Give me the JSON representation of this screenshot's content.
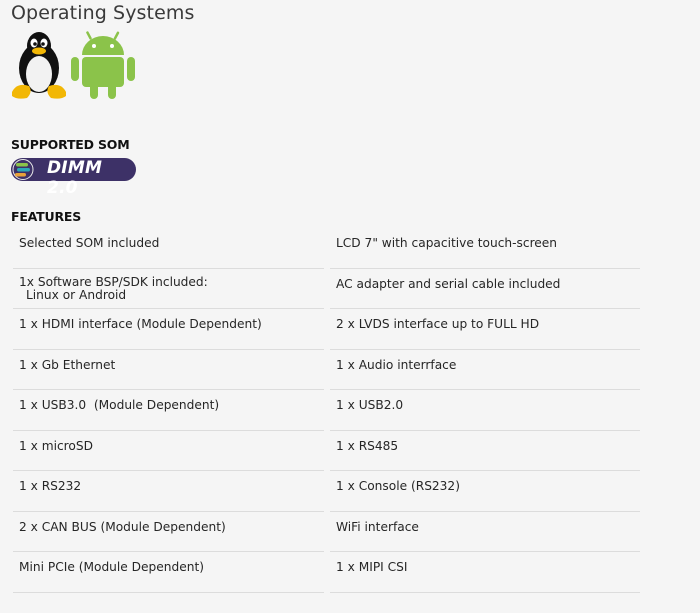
{
  "heading": "Operating Systems",
  "os_icons": [
    "linux-tux-icon",
    "android-icon"
  ],
  "supported_som": {
    "label": "SUPPORTED SOM",
    "badge_text": "DIMM 2.0",
    "badge_color": "#3d3167"
  },
  "features": {
    "label": "FEATURES",
    "rows": [
      {
        "left": "Selected SOM included",
        "right": "LCD 7\" with capacitive touch-screen"
      },
      {
        "left": "1x Software BSP/SDK included:",
        "left_sub": "Linux or Android",
        "right": "AC adapter and serial cable included"
      },
      {
        "left": "1 x HDMI interface (Module Dependent)",
        "right": "2 x LVDS interface up to FULL HD"
      },
      {
        "left": "1 x Gb Ethernet",
        "right": "1 x Audio interrface"
      },
      {
        "left": "1 x USB3.0  (Module Dependent)",
        "right": "1 x USB2.0"
      },
      {
        "left": "1 x microSD",
        "right": "1 x RS485"
      },
      {
        "left": "1 x RS232",
        "right": "1 x Console (RS232)"
      },
      {
        "left": "2 x CAN BUS (Module Dependent)",
        "right": "WiFi interface"
      },
      {
        "left": "Mini PCIe (Module Dependent)",
        "right": "1 x MIPI CSI"
      }
    ]
  },
  "colors": {
    "android_green": "#8bc34a",
    "badge_bg": "#3d3167",
    "divider": "#dcdcdc"
  }
}
